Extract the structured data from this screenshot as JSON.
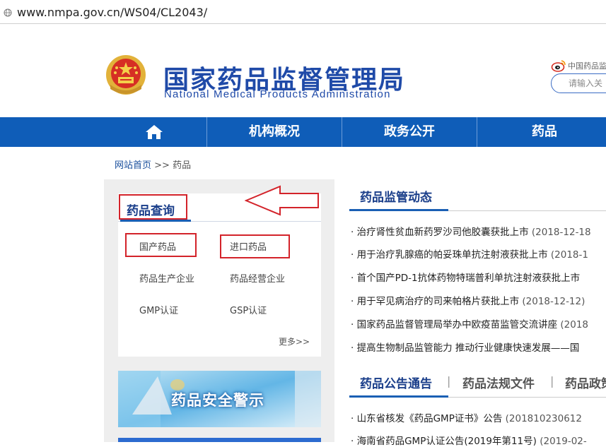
{
  "address_bar": {
    "url": "www.nmpa.gov.cn/WS04/CL2043/"
  },
  "header": {
    "logo_cn": "国家药品监督管理局",
    "logo_en": "National Medical Products Administration",
    "weibo_text": "中国药品监",
    "search_placeholder": "请输入关"
  },
  "nav": {
    "items": [
      "机构概况",
      "政务公开",
      "药品"
    ]
  },
  "breadcrumb": {
    "home": "网站首页",
    "sep": ">>",
    "current": "药品"
  },
  "query": {
    "title": "药品查询",
    "links": [
      "国产药品",
      "进口药品",
      "药品生产企业",
      "药品经营企业",
      "GMP认证",
      "GSP认证"
    ],
    "more": "更多>>"
  },
  "banner": {
    "text": "药品安全警示"
  },
  "news_section": {
    "title": "药品监管动态",
    "items": [
      {
        "text": "治疗肾性贫血新药罗沙司他胶囊获批上市",
        "date": "(2018-12-18"
      },
      {
        "text": "用于治疗乳腺癌的帕妥珠单抗注射液获批上市",
        "date": "(2018-1"
      },
      {
        "text": "首个国产PD-1抗体药物特瑞普利单抗注射液获批上市",
        "date": ""
      },
      {
        "text": "用于罕见病治疗的司来帕格片获批上市",
        "date": "(2018-12-12)"
      },
      {
        "text": "国家药品监督管理局举办中欧疫苗监管交流讲座",
        "date": "(2018"
      },
      {
        "text": "提高生物制品监管能力 推动行业健康快速发展——国",
        "date": ""
      }
    ]
  },
  "notice_section": {
    "tabs": [
      "药品公告通告",
      "药品法规文件",
      "药品政策"
    ],
    "sep": "|",
    "items": [
      {
        "text": "山东省核发《药品GMP证书》公告",
        "date": "(201810230612"
      },
      {
        "text": "海南省药品GMP认证公告(2019年第11号)",
        "date": "(2019-02-"
      }
    ]
  },
  "colors": {
    "nav_blue": "#0f5db8",
    "title_blue": "#1a3e8a",
    "highlight_red": "#d3232a"
  }
}
